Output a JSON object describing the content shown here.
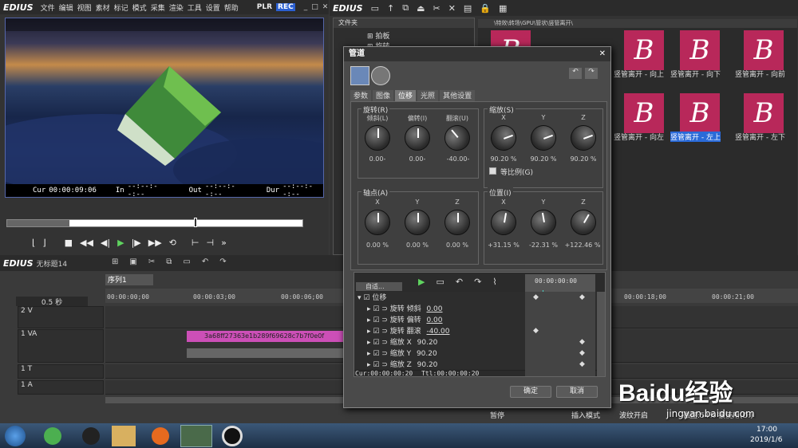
{
  "player": {
    "logo": "EDIUS",
    "menu": [
      "文件",
      "编辑",
      "视图",
      "素材",
      "标记",
      "模式",
      "采集",
      "渲染",
      "工具",
      "设置",
      "帮助"
    ],
    "mode_plr": "PLR",
    "mode_rec": "REC",
    "cur_label": "Cur",
    "cur": "00:00:09:06",
    "in_label": "In",
    "in": "--:--:--:--",
    "out_label": "Out",
    "out": "--:--:--:--",
    "dur_label": "Dur",
    "dur": "--:--:--:--"
  },
  "bin": {
    "logo": "EDIUS",
    "folder_header": "文件夹",
    "tree": [
      "拍板",
      "旋转"
    ],
    "path": "\\特效\\转场\\GPU\\管状\\竖管离开\\",
    "thumbs": [
      {
        "label": "竖管离开 - 向上",
        "selected": false
      },
      {
        "label": "竖管离开 - 向下",
        "selected": false
      },
      {
        "label": "竖管离开 - 向前",
        "selected": false
      },
      {
        "label": "竖管离开 - 向左",
        "selected": false
      },
      {
        "label": "竖管离开 - 左上",
        "selected": true
      },
      {
        "label": "竖管离开 - 左下",
        "selected": false
      }
    ]
  },
  "dialog": {
    "title": "管道",
    "tabs": [
      "参数",
      "图像",
      "位移",
      "光照",
      "其他设置"
    ],
    "active_tab": "位移",
    "rotation": {
      "title": "旋转(R)",
      "knobs": [
        {
          "label": "倾斜(L)",
          "value": "0.00-"
        },
        {
          "label": "偏转(I)",
          "value": "0.00-"
        },
        {
          "label": "翻滚(U)",
          "value": "-40.00-"
        }
      ]
    },
    "scale": {
      "title": "缩放(S)",
      "knobs": [
        {
          "label": "X",
          "value": "90.20 %"
        },
        {
          "label": "Y",
          "value": "90.20 %"
        },
        {
          "label": "Z",
          "value": "90.20 %"
        }
      ],
      "checkbox": "等比例(G)"
    },
    "pivot": {
      "title": "轴点(A)",
      "knobs": [
        {
          "label": "X",
          "value": "0.00 %"
        },
        {
          "label": "Y",
          "value": "0.00 %"
        },
        {
          "label": "Z",
          "value": "0.00 %"
        }
      ]
    },
    "position": {
      "title": "位置(I)",
      "knobs": [
        {
          "label": "X",
          "value": "+31.15 %"
        },
        {
          "label": "Y",
          "value": "-22.31 %"
        },
        {
          "label": "Z",
          "value": "+122.46 %"
        }
      ]
    },
    "kf_mode": "自适...",
    "kf_time": "00:00:00:00",
    "kf_group": "位移",
    "kf_rows": [
      {
        "name": "旋转 倾斜",
        "value": "0.00"
      },
      {
        "name": "旋转 偏转",
        "value": "0.00"
      },
      {
        "name": "旋转 翻滚",
        "value": "-40.00"
      },
      {
        "name": "缩放 X",
        "value": "90.20"
      },
      {
        "name": "缩放 Y",
        "value": "90.20"
      },
      {
        "name": "缩放 Z",
        "value": "90.20"
      }
    ],
    "cur_label": "Cur:",
    "cur": "00:00:00:20",
    "ttl_label": "Ttl:",
    "ttl": "00:00:00:20",
    "ok": "确定",
    "cancel": "取消"
  },
  "timeline": {
    "logo": "EDIUS",
    "project": "无标题14",
    "sequence": "序列1",
    "zoom": "0.5 秒",
    "ruler": [
      "00:00:00;00",
      "00:00:03;00",
      "00:00:06;00",
      "00:00:18;00",
      "00:00:21;00"
    ],
    "tracks": [
      "2 V",
      "1 VA",
      "1 T",
      "1 A"
    ],
    "clip": "3a68ff27363e1b289f69628c7b7f0e0f"
  },
  "statusbar": {
    "pause": "暂停",
    "insert": "插入模式",
    "ripple": "波纹开启",
    "disk": "磁盘:54% 被使用(D:)"
  },
  "taskbar": {
    "time": "17:00",
    "date": "2019/1/6"
  },
  "watermark": {
    "brand": "Baidu经验",
    "url": "jingyan.baidu.com"
  }
}
